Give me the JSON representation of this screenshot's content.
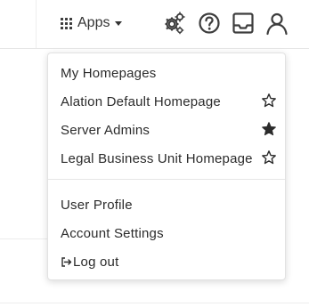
{
  "topbar": {
    "apps_label": "Apps",
    "icons": [
      "settings-gears-icon",
      "help-circle-icon",
      "inbox-icon",
      "user-profile-icon"
    ]
  },
  "menu": {
    "homepages_header": "My Homepages",
    "homepages": [
      {
        "label": "Alation Default Homepage",
        "starred": false
      },
      {
        "label": "Server Admins",
        "starred": true
      },
      {
        "label": "Legal Business Unit Homepage",
        "starred": false
      }
    ],
    "user_profile": "User Profile",
    "account_settings": "Account Settings",
    "log_out": "Log out"
  },
  "colors": {
    "text": "#2b2b2b",
    "icon": "#3d3d3d",
    "divider": "#e6e6e6"
  }
}
